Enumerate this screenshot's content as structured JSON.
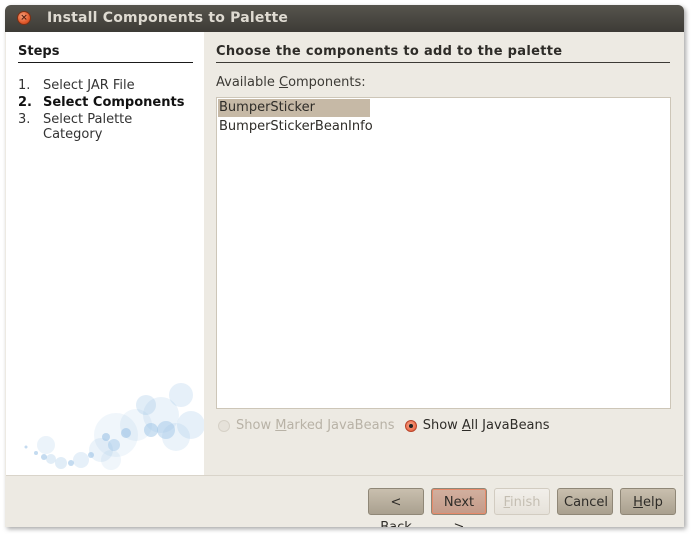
{
  "window": {
    "title": "Install Components to Palette",
    "close_icon": "close-icon"
  },
  "steps": {
    "title": "Steps",
    "items": [
      {
        "num": "1.",
        "label": "Select JAR File",
        "active": false
      },
      {
        "num": "2.",
        "label": "Select Components",
        "active": true
      },
      {
        "num": "3.",
        "label": "Select Palette Category",
        "active": false
      }
    ]
  },
  "main": {
    "title": "Choose the components to add to the palette",
    "available_label_pre": "Available ",
    "available_label_mnemonic": "C",
    "available_label_post": "omponents:",
    "components": [
      {
        "name": "BumperSticker",
        "selected": true
      },
      {
        "name": "BumperStickerBeanInfo",
        "selected": false
      }
    ],
    "radio_marked": {
      "pre": "Show ",
      "mnemonic": "M",
      "post": "arked JavaBeans",
      "checked": false,
      "enabled": false
    },
    "radio_all": {
      "pre": "Show ",
      "mnemonic": "A",
      "post": "ll JavaBeans",
      "checked": true,
      "enabled": true
    }
  },
  "buttons": {
    "back": {
      "pre": "< ",
      "mnemonic": "B",
      "post": "ack"
    },
    "next": {
      "label": "Next >"
    },
    "finish": {
      "pre": "",
      "mnemonic": "F",
      "post": "inish"
    },
    "cancel": {
      "label": "Cancel"
    },
    "help": {
      "pre": "",
      "mnemonic": "H",
      "post": "elp"
    }
  },
  "colors": {
    "title_bar": "#3d3b36",
    "selection": "#c6b9a6",
    "accent": "#e4542f"
  }
}
